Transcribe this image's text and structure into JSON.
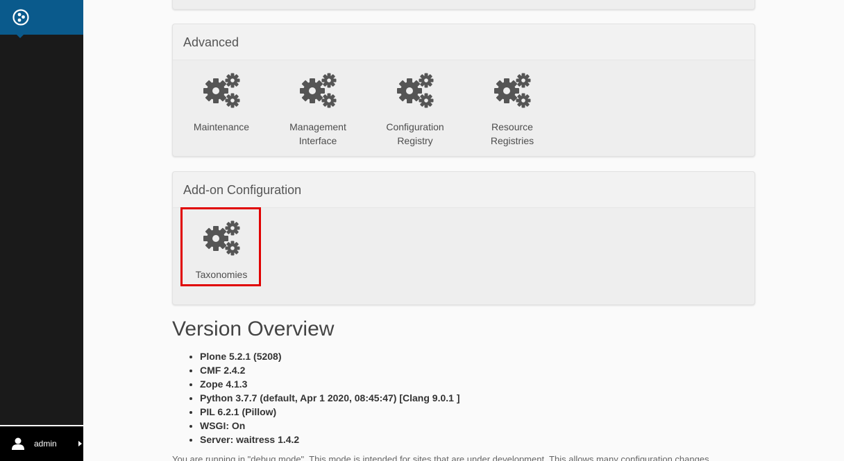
{
  "toolbar": {
    "user_label": "admin"
  },
  "advanced": {
    "title": "Advanced",
    "items": [
      {
        "label_line1": "Maintenance",
        "label_line2": ""
      },
      {
        "label_line1": "Management",
        "label_line2": "Interface"
      },
      {
        "label_line1": "Configuration",
        "label_line2": "Registry"
      },
      {
        "label_line1": "Resource",
        "label_line2": "Registries"
      }
    ]
  },
  "addon": {
    "title": "Add-on Configuration",
    "items": [
      {
        "label_line1": "Taxonomies",
        "label_line2": ""
      }
    ]
  },
  "version": {
    "title": "Version Overview",
    "items": [
      "Plone 5.2.1 (5208)",
      "CMF 2.4.2",
      "Zope 4.1.3",
      "Python 3.7.7 (default, Apr 1 2020, 08:45:47) [Clang 9.0.1 ]",
      "PIL 6.2.1 (Pillow)",
      "WSGI: On",
      "Server: waitress 1.4.2"
    ],
    "note": "You are running in \"debug mode\". This mode is intended for sites that are under development. This allows many configuration changes"
  },
  "colors": {
    "toolbar": "#1a1a1a",
    "logo_bg": "#0a5a8c",
    "highlight": "#e00000",
    "icon": "#555555"
  }
}
